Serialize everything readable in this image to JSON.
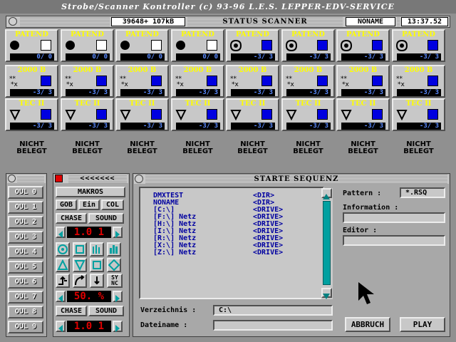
{
  "app": {
    "title": "Strobe/Scanner Kontroller (c) 93-96 L.E.S. LEPPER-EDV-SERVICE"
  },
  "status": {
    "memory": "39648+ 107kB",
    "title": "STATUS SCANNER",
    "name": "NONAME",
    "time": "13:37.52"
  },
  "grid": {
    "row1": [
      {
        "label": "PATEND",
        "value": "0/ 0",
        "icon": "dot"
      },
      {
        "label": "PATEND",
        "value": "0/ 0",
        "icon": "dot"
      },
      {
        "label": "PATEND",
        "value": "0/ 0",
        "icon": "dot"
      },
      {
        "label": "PATEND",
        "value": "0/ 0",
        "icon": "dot"
      },
      {
        "label": "PATEND",
        "value": "-3/ 3",
        "icon": "spiral"
      },
      {
        "label": "PATEND",
        "value": "-3/ 3",
        "icon": "spiral"
      },
      {
        "label": "PATEND",
        "value": "-3/ 3",
        "icon": "spiral"
      },
      {
        "label": "PATEND",
        "value": "-3/ 3",
        "icon": "spiral"
      }
    ],
    "row2": [
      {
        "label": "2000 B",
        "value": "-3/ 3"
      },
      {
        "label": "2000 B",
        "value": "-3/ 3"
      },
      {
        "label": "2000 B",
        "value": "-3/ 3"
      },
      {
        "label": "2000 B",
        "value": "-3/ 3"
      },
      {
        "label": "2000 B",
        "value": "-3/ 3"
      },
      {
        "label": "2000 B",
        "value": "-3/ 3"
      },
      {
        "label": "2000 B",
        "value": "-3/ 3"
      },
      {
        "label": "2000 B",
        "value": "-3/ 3"
      }
    ],
    "row3": [
      {
        "label": "TEC II",
        "value": "-3/ 3"
      },
      {
        "label": "TEC II",
        "value": "-3/ 3"
      },
      {
        "label": "TEC II",
        "value": "-3/ 3"
      },
      {
        "label": "TEC II",
        "value": "-3/ 3"
      },
      {
        "label": "TEC II",
        "value": "-3/ 3"
      },
      {
        "label": "TEC II",
        "value": "-3/ 3"
      },
      {
        "label": "TEC II",
        "value": "-3/ 3"
      },
      {
        "label": "TEC II",
        "value": "-3/ 3"
      }
    ],
    "nicht": "NICHT",
    "belegt": "BELEGT"
  },
  "colors": {
    "blue": "#0000e0",
    "white": "#ffffff",
    "yellow": "#ffff00",
    "segRed": "#e00000"
  },
  "oul": [
    "OUL 0",
    "OUL 1",
    "OUL 2",
    "OUL 3",
    "OUL 4",
    "OUL 5",
    "OUL 6",
    "OUL 7",
    "OUL 8",
    "OUL 9"
  ],
  "makros": {
    "header": "<<<<<<<",
    "title": "MAKROS",
    "gob": "GOB",
    "ein": "Ein",
    "col": "COL",
    "chase": "CHASE",
    "sound": "SOUND",
    "seg1": "1.0 1",
    "seg2": "50. %",
    "seg3": "1.0 1",
    "chase2": "CHASE",
    "sound2": "SOUND",
    "sync": "SY NC"
  },
  "dialog": {
    "title": "STARTE SEQUENZ",
    "files": [
      {
        "name": "DMXTEST",
        "type": "<DIR>"
      },
      {
        "name": "NONAME",
        "type": "<DIR>"
      },
      {
        "name": "[C:\\]",
        "type": "<DRIVE>"
      },
      {
        "name": "[F:\\] Netz",
        "type": "<DRIVE>"
      },
      {
        "name": "[H:\\] Netz",
        "type": "<DRIVE>"
      },
      {
        "name": "[I:\\] Netz",
        "type": "<DRIVE>"
      },
      {
        "name": "[R:\\] Netz",
        "type": "<DRIVE>"
      },
      {
        "name": "[X:\\] Netz",
        "type": "<DRIVE>"
      },
      {
        "name": "[Z:\\] Netz",
        "type": "<DRIVE>"
      }
    ],
    "pattern_label": "Pattern :",
    "pattern_value": "*.RSQ",
    "info_label": "Information :",
    "editor_label": "Editor :",
    "dir_label": "Verzeichnis :",
    "dir_value": "C:\\",
    "file_label": "Dateiname :",
    "file_value": "",
    "abbruch": "ABBRUCH",
    "play": "PLAY"
  }
}
